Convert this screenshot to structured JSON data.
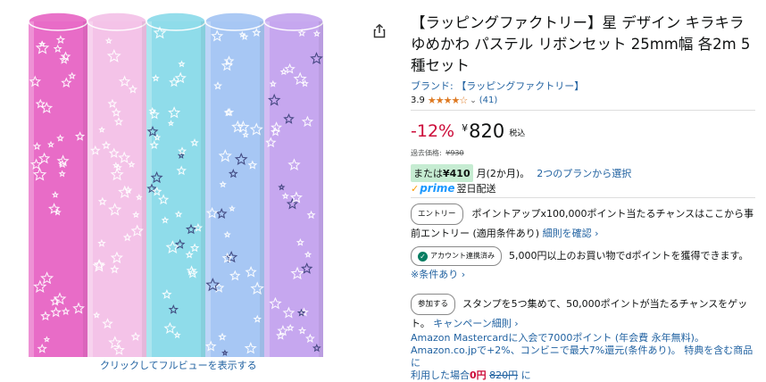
{
  "product": {
    "title": "【ラッピングファクトリー】星 デザイン キラキラ ゆめかわ パステル リボンセット 25mm幅 各2m 5種セット",
    "brand_text": "ブランド: 【ラッピングファクトリー】",
    "rating_value": "3.9",
    "rating_stars": 3.9,
    "rating_count": "(41)",
    "image_caption": "クリックしてフルビューを表示する",
    "ribbon_colors": [
      "#e86cc7",
      "#f4c3e8",
      "#8fdcea",
      "#a7c7f4",
      "#c6a7ef"
    ]
  },
  "price": {
    "discount": "-12%",
    "currency": "¥",
    "amount": "820",
    "tax_label": "税込",
    "past_label": "過去価格:",
    "past_price": "¥930"
  },
  "installment": {
    "prefix": "または",
    "amount": "¥410",
    "term": "月(2か月)。",
    "link": "2つのプランから選択"
  },
  "prime": {
    "logo": "prime",
    "delivery": "翌日配送"
  },
  "promos": {
    "entry_button": "エントリー",
    "entry_text": "ポイントアップx100,000ポイント当たるチャンスはここから事前エントリー (適用条件あり)",
    "entry_link": "細則を確認",
    "entry_link_suffix": "›",
    "dpoint_badge": "アカウント連携済み",
    "dpoint_text": "5,000円以上のお買い物でdポイントを獲得できます。",
    "dpoint_link": "※条件あり",
    "dpoint_link_suffix": "›",
    "stamp_button": "参加する",
    "stamp_text": "スタンプを5つ集めて、50,000ポイントが当たるチャンスをゲット。",
    "stamp_link": "キャンペーン細則",
    "stamp_link_suffix": "›"
  },
  "card_offer": {
    "line1": "Amazon Mastercardに入会で7000ポイント (年会費 永年無料)。",
    "line2": "Amazon.co.jpで+2%、コンビニで最大7%還元(条件あり)。 特典を含む商品に",
    "line3_prefix": "利用した場合",
    "line3_price": "0円",
    "line3_strike": "820円",
    "line3_suffix": "に"
  },
  "icons": {
    "share": "share-icon",
    "chevron": "chevron-down-icon",
    "check": "check-icon"
  },
  "colors": {
    "link": "#2162a1",
    "discount": "#CC0C39",
    "star": "#de7921",
    "install_badge": "#c6ecd2",
    "prime": "#1a98ff",
    "check_green": "#067D62"
  }
}
